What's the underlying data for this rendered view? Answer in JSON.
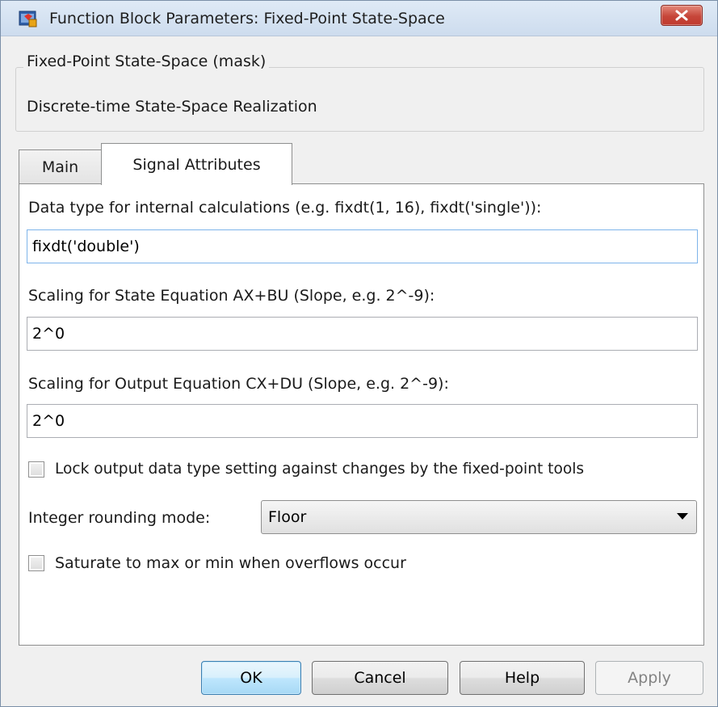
{
  "window": {
    "title": "Function Block Parameters: Fixed-Point State-Space",
    "close_symbol": "✕",
    "icon": "simulink-block-icon"
  },
  "mask": {
    "title": "Fixed-Point State-Space (mask)",
    "description": "Discrete-time State-Space Realization"
  },
  "tabs": [
    {
      "label": "Main",
      "selected": false
    },
    {
      "label": "Signal Attributes",
      "selected": true
    }
  ],
  "params": {
    "internal_dtype_label": "Data type for internal calculations (e.g. fixdt(1, 16), fixdt('single')):",
    "internal_dtype_value": "fixdt('double')",
    "state_scaling_label": "Scaling for State Equation AX+BU (Slope, e.g. 2^-9):",
    "state_scaling_value": "2^0",
    "output_scaling_label": "Scaling for Output Equation CX+DU (Slope, e.g. 2^-9):",
    "output_scaling_value": "2^0",
    "lock_label": "Lock output data type setting against changes by the fixed-point tools",
    "lock_checked": false,
    "rounding_label": "Integer rounding mode:",
    "rounding_value": "Floor",
    "saturate_label": "Saturate to max or min when overflows occur",
    "saturate_checked": false
  },
  "buttons": {
    "ok": "OK",
    "cancel": "Cancel",
    "help": "Help",
    "apply": "Apply"
  },
  "colors": {
    "close_button": "#c6463a",
    "default_button_border": "#3c7fb1",
    "focus_border": "#7eb4ea",
    "disabled_text": "#838383"
  }
}
